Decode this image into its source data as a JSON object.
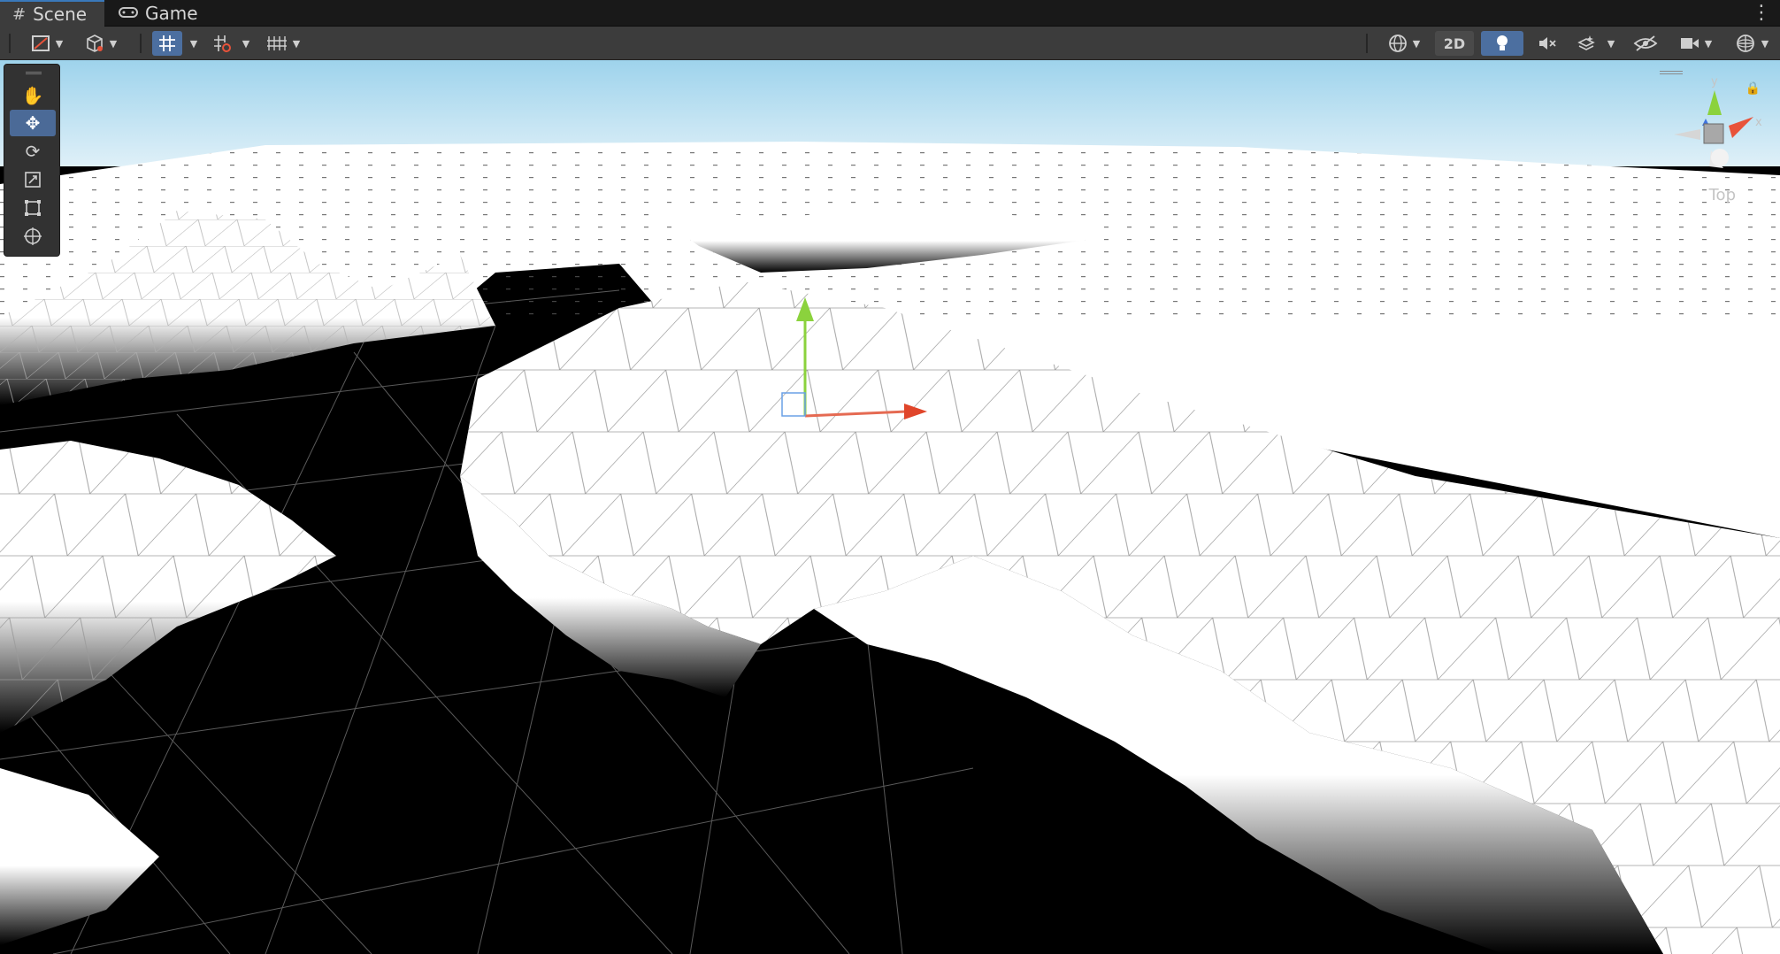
{
  "tabs": [
    {
      "label": "Scene",
      "icon": "hash-icon",
      "active": true
    },
    {
      "label": "Game",
      "icon": "gamepad-icon",
      "active": false
    }
  ],
  "toolbar": {
    "two_d_label": "2D",
    "buttons": [
      "draw-mode",
      "render-mode",
      "grid-snap",
      "increment-snap",
      "grid-toggle",
      "camera-view",
      "lighting",
      "audio",
      "effects",
      "scene-visibility",
      "camera-settings",
      "gizmos"
    ]
  },
  "tools": [
    "hand-tool",
    "move-tool",
    "rotate-tool",
    "scale-tool",
    "rect-tool",
    "transform-tool"
  ],
  "active_tool": "move-tool",
  "gizmo": {
    "label": "Top",
    "axes": {
      "y": "y",
      "x": "x"
    },
    "colors": {
      "x": "#e8533a",
      "y": "#7bd23a",
      "z": "#3f74e0"
    }
  },
  "colors": {
    "accent": "#4c6fa0",
    "sky_top": "#9ed3ec",
    "sky_bottom": "#e8f4f9"
  }
}
